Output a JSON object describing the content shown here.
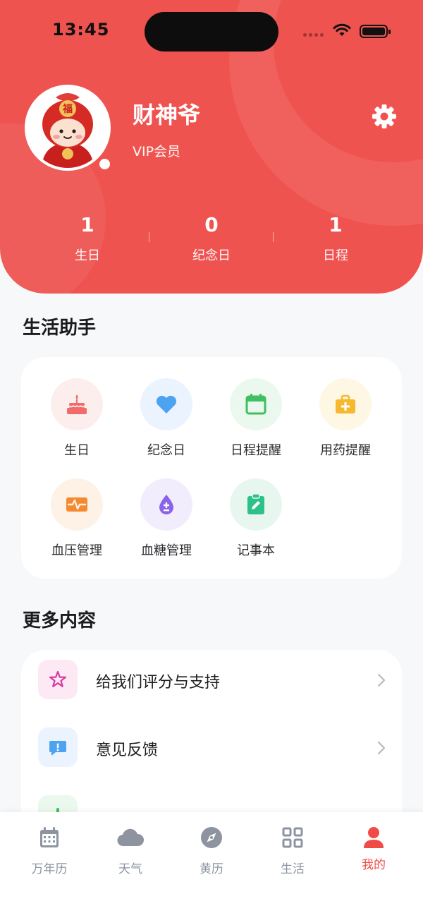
{
  "status_bar": {
    "time": "13:45"
  },
  "profile": {
    "name": "财神爷",
    "membership": "VIP会员",
    "avatar_text": "福"
  },
  "stats": [
    {
      "value": "1",
      "label": "生日"
    },
    {
      "value": "0",
      "label": "纪念日"
    },
    {
      "value": "1",
      "label": "日程"
    }
  ],
  "life_assistant": {
    "title": "生活助手",
    "tools": [
      {
        "label": "生日",
        "icon": "cake-icon",
        "color": "#f26b6b",
        "bg": "#fdeeee"
      },
      {
        "label": "纪念日",
        "icon": "heart-icon",
        "color": "#4ea3f1",
        "bg": "#eaf3fe"
      },
      {
        "label": "日程提醒",
        "icon": "calendar-icon",
        "color": "#3fbf5f",
        "bg": "#eaf8ee"
      },
      {
        "label": "用药提醒",
        "icon": "medkit-icon",
        "color": "#f5b82e",
        "bg": "#fef7e4"
      },
      {
        "label": "血压管理",
        "icon": "pulse-icon",
        "color": "#f48a2d",
        "bg": "#fef1e6"
      },
      {
        "label": "血糖管理",
        "icon": "drop-icon",
        "color": "#8b63e8",
        "bg": "#f1edfd"
      },
      {
        "label": "记事本",
        "icon": "notepad-icon",
        "color": "#2cc08a",
        "bg": "#e7f7f0"
      }
    ]
  },
  "more": {
    "title": "更多内容",
    "items": [
      {
        "label": "给我们评分与支持",
        "icon": "star-icon",
        "color": "#d63aa3",
        "bg": "#fce9f4"
      },
      {
        "label": "意见反馈",
        "icon": "feedback-icon",
        "color": "#4ea3f1",
        "bg": "#eaf3fe"
      }
    ]
  },
  "tabs": [
    {
      "label": "万年历",
      "icon": "calendar-icon"
    },
    {
      "label": "天气",
      "icon": "cloud-icon"
    },
    {
      "label": "黄历",
      "icon": "compass-icon"
    },
    {
      "label": "生活",
      "icon": "grid-icon"
    },
    {
      "label": "我的",
      "icon": "person-icon",
      "active": true
    }
  ],
  "colors": {
    "primary": "#ef5350",
    "active_tab": "#ef4b47",
    "inactive_tab": "#8d94a0"
  }
}
